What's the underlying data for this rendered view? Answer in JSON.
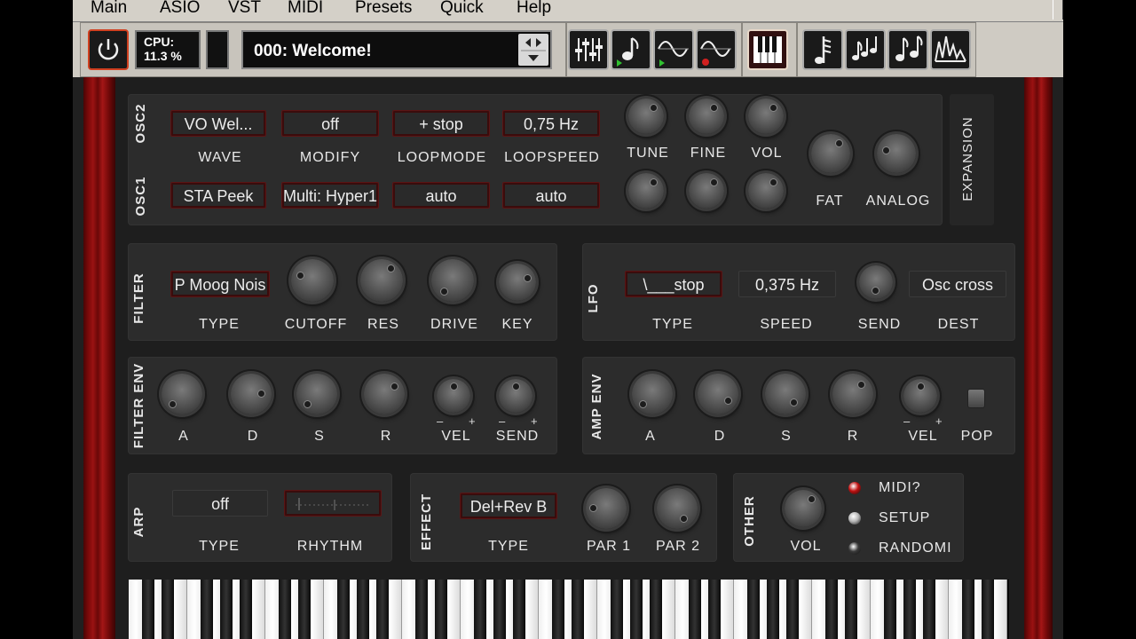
{
  "menu": [
    "Main",
    "ASIO",
    "VST",
    "MIDI",
    "Presets",
    "Quick",
    "Help"
  ],
  "toolbar": {
    "cpu_label": "CPU:",
    "cpu_value": "11.3 %",
    "preset_name": "000: Welcome!",
    "icons": [
      "power-icon",
      "mixer-icon",
      "note-icon",
      "waveform-green-icon",
      "waveform-red-icon",
      "piano-icon",
      "sequencer-icon",
      "notes-icon",
      "double-note-icon",
      "spectrum-icon"
    ]
  },
  "osc": {
    "osc2_label": "OSC2",
    "osc1_label": "OSC1",
    "osc2_values": [
      "VO Wel...",
      "off",
      "+ stop",
      "0,75 Hz"
    ],
    "osc1_values": [
      "STA Peek",
      "Multi: Hyper1",
      "auto",
      "auto"
    ],
    "col_labels": [
      "WAVE",
      "MODIFY",
      "LOOPMODE",
      "LOOPSPEED"
    ],
    "knob_labels": [
      "TUNE",
      "FINE",
      "VOL"
    ],
    "fat_label": "FAT",
    "analog_label": "ANALOG",
    "expansion_label": "EXPANSION"
  },
  "filter": {
    "label": "FILTER",
    "type_value": "P Moog Nois",
    "labels": [
      "TYPE",
      "CUTOFF",
      "RES",
      "DRIVE",
      "KEY"
    ]
  },
  "lfo": {
    "label": "LFO",
    "type_value": "\\___stop",
    "speed_value": "0,375 Hz",
    "dest_value": "Osc cross",
    "labels": [
      "TYPE",
      "SPEED",
      "SEND",
      "DEST"
    ]
  },
  "filter_env": {
    "label": "FILTER ENV",
    "labels": [
      "A",
      "D",
      "S",
      "R",
      "VEL",
      "SEND"
    ],
    "minus": "–",
    "plus": "+"
  },
  "amp_env": {
    "label": "AMP ENV",
    "labels": [
      "A",
      "D",
      "S",
      "R",
      "VEL",
      "POP"
    ],
    "minus": "–",
    "plus": "+"
  },
  "arp": {
    "label": "ARP",
    "type_value": "off",
    "labels": [
      "TYPE",
      "RHYTHM"
    ]
  },
  "effect": {
    "label": "EFFECT",
    "type_value": "Del+Rev B",
    "labels": [
      "TYPE",
      "PAR 1",
      "PAR 2"
    ]
  },
  "other": {
    "label": "OTHER",
    "vol_label": "VOL",
    "options": [
      "MIDI?",
      "SETUP",
      "RANDOMI"
    ],
    "led_colors": [
      "#c01010",
      "#b8b8b8",
      "#3a3a3a"
    ]
  },
  "colors": {
    "accent": "#8a1010",
    "panel": "#2c2c2c",
    "wood": "#9a1212"
  }
}
